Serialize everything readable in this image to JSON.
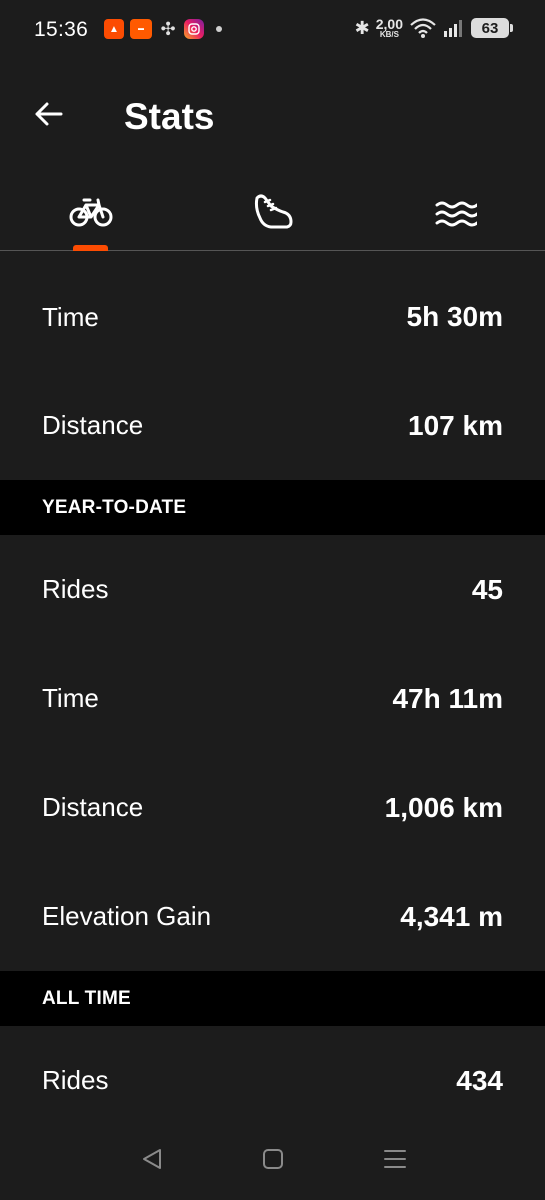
{
  "status_bar": {
    "time": "15:36",
    "net_speed_value": "2,00",
    "net_speed_unit": "KB/S",
    "battery": "63",
    "icons": [
      "strava-icon",
      "allegro-icon",
      "fan-icon",
      "instagram-icon",
      "dot-icon",
      "bluetooth-icon",
      "wifi-icon",
      "signal-icon",
      "battery-icon"
    ]
  },
  "header": {
    "title": "Stats"
  },
  "tabs": [
    {
      "icon": "bike-icon",
      "selected": true
    },
    {
      "icon": "shoe-icon",
      "selected": false
    },
    {
      "icon": "swim-icon",
      "selected": false
    }
  ],
  "recent": [
    {
      "label": "Time",
      "value": "5h 30m"
    },
    {
      "label": "Distance",
      "value": "107 km"
    }
  ],
  "year_to_date": {
    "title": "YEAR-TO-DATE",
    "rows": [
      {
        "label": "Rides",
        "value": "45"
      },
      {
        "label": "Time",
        "value": "47h 11m"
      },
      {
        "label": "Distance",
        "value": "1,006 km"
      },
      {
        "label": "Elevation Gain",
        "value": "4,341 m"
      }
    ]
  },
  "all_time": {
    "title": "ALL TIME",
    "rows": [
      {
        "label": "Rides",
        "value": "434"
      }
    ]
  },
  "colors": {
    "accent": "#fc4c02",
    "background": "#1c1c1c",
    "section_background": "#000000"
  }
}
